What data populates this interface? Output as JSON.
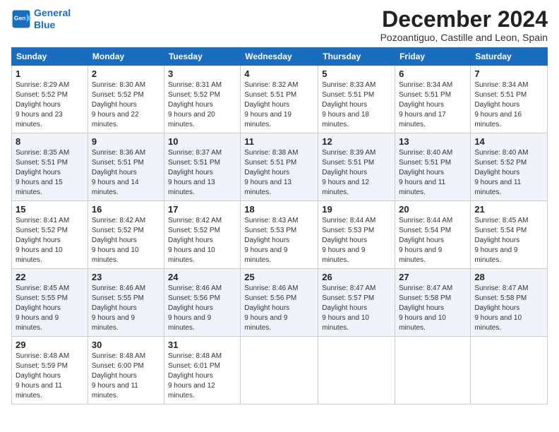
{
  "logo": {
    "line1": "General",
    "line2": "Blue"
  },
  "title": "December 2024",
  "subtitle": "Pozoantiguo, Castille and Leon, Spain",
  "header": {
    "days": [
      "Sunday",
      "Monday",
      "Tuesday",
      "Wednesday",
      "Thursday",
      "Friday",
      "Saturday"
    ]
  },
  "weeks": [
    [
      {
        "day": 1,
        "sunrise": "8:29 AM",
        "sunset": "5:52 PM",
        "daylight": "9 hours and 23 minutes."
      },
      {
        "day": 2,
        "sunrise": "8:30 AM",
        "sunset": "5:52 PM",
        "daylight": "9 hours and 22 minutes."
      },
      {
        "day": 3,
        "sunrise": "8:31 AM",
        "sunset": "5:52 PM",
        "daylight": "9 hours and 20 minutes."
      },
      {
        "day": 4,
        "sunrise": "8:32 AM",
        "sunset": "5:51 PM",
        "daylight": "9 hours and 19 minutes."
      },
      {
        "day": 5,
        "sunrise": "8:33 AM",
        "sunset": "5:51 PM",
        "daylight": "9 hours and 18 minutes."
      },
      {
        "day": 6,
        "sunrise": "8:34 AM",
        "sunset": "5:51 PM",
        "daylight": "9 hours and 17 minutes."
      },
      {
        "day": 7,
        "sunrise": "8:34 AM",
        "sunset": "5:51 PM",
        "daylight": "9 hours and 16 minutes."
      }
    ],
    [
      {
        "day": 8,
        "sunrise": "8:35 AM",
        "sunset": "5:51 PM",
        "daylight": "9 hours and 15 minutes."
      },
      {
        "day": 9,
        "sunrise": "8:36 AM",
        "sunset": "5:51 PM",
        "daylight": "9 hours and 14 minutes."
      },
      {
        "day": 10,
        "sunrise": "8:37 AM",
        "sunset": "5:51 PM",
        "daylight": "9 hours and 13 minutes."
      },
      {
        "day": 11,
        "sunrise": "8:38 AM",
        "sunset": "5:51 PM",
        "daylight": "9 hours and 13 minutes."
      },
      {
        "day": 12,
        "sunrise": "8:39 AM",
        "sunset": "5:51 PM",
        "daylight": "9 hours and 12 minutes."
      },
      {
        "day": 13,
        "sunrise": "8:40 AM",
        "sunset": "5:51 PM",
        "daylight": "9 hours and 11 minutes."
      },
      {
        "day": 14,
        "sunrise": "8:40 AM",
        "sunset": "5:52 PM",
        "daylight": "9 hours and 11 minutes."
      }
    ],
    [
      {
        "day": 15,
        "sunrise": "8:41 AM",
        "sunset": "5:52 PM",
        "daylight": "9 hours and 10 minutes."
      },
      {
        "day": 16,
        "sunrise": "8:42 AM",
        "sunset": "5:52 PM",
        "daylight": "9 hours and 10 minutes."
      },
      {
        "day": 17,
        "sunrise": "8:42 AM",
        "sunset": "5:52 PM",
        "daylight": "9 hours and 10 minutes."
      },
      {
        "day": 18,
        "sunrise": "8:43 AM",
        "sunset": "5:53 PM",
        "daylight": "9 hours and 9 minutes."
      },
      {
        "day": 19,
        "sunrise": "8:44 AM",
        "sunset": "5:53 PM",
        "daylight": "9 hours and 9 minutes."
      },
      {
        "day": 20,
        "sunrise": "8:44 AM",
        "sunset": "5:54 PM",
        "daylight": "9 hours and 9 minutes."
      },
      {
        "day": 21,
        "sunrise": "8:45 AM",
        "sunset": "5:54 PM",
        "daylight": "9 hours and 9 minutes."
      }
    ],
    [
      {
        "day": 22,
        "sunrise": "8:45 AM",
        "sunset": "5:55 PM",
        "daylight": "9 hours and 9 minutes."
      },
      {
        "day": 23,
        "sunrise": "8:46 AM",
        "sunset": "5:55 PM",
        "daylight": "9 hours and 9 minutes."
      },
      {
        "day": 24,
        "sunrise": "8:46 AM",
        "sunset": "5:56 PM",
        "daylight": "9 hours and 9 minutes."
      },
      {
        "day": 25,
        "sunrise": "8:46 AM",
        "sunset": "5:56 PM",
        "daylight": "9 hours and 9 minutes."
      },
      {
        "day": 26,
        "sunrise": "8:47 AM",
        "sunset": "5:57 PM",
        "daylight": "9 hours and 10 minutes."
      },
      {
        "day": 27,
        "sunrise": "8:47 AM",
        "sunset": "5:58 PM",
        "daylight": "9 hours and 10 minutes."
      },
      {
        "day": 28,
        "sunrise": "8:47 AM",
        "sunset": "5:58 PM",
        "daylight": "9 hours and 10 minutes."
      }
    ],
    [
      {
        "day": 29,
        "sunrise": "8:48 AM",
        "sunset": "5:59 PM",
        "daylight": "9 hours and 11 minutes."
      },
      {
        "day": 30,
        "sunrise": "8:48 AM",
        "sunset": "6:00 PM",
        "daylight": "9 hours and 11 minutes."
      },
      {
        "day": 31,
        "sunrise": "8:48 AM",
        "sunset": "6:01 PM",
        "daylight": "9 hours and 12 minutes."
      },
      null,
      null,
      null,
      null
    ]
  ]
}
